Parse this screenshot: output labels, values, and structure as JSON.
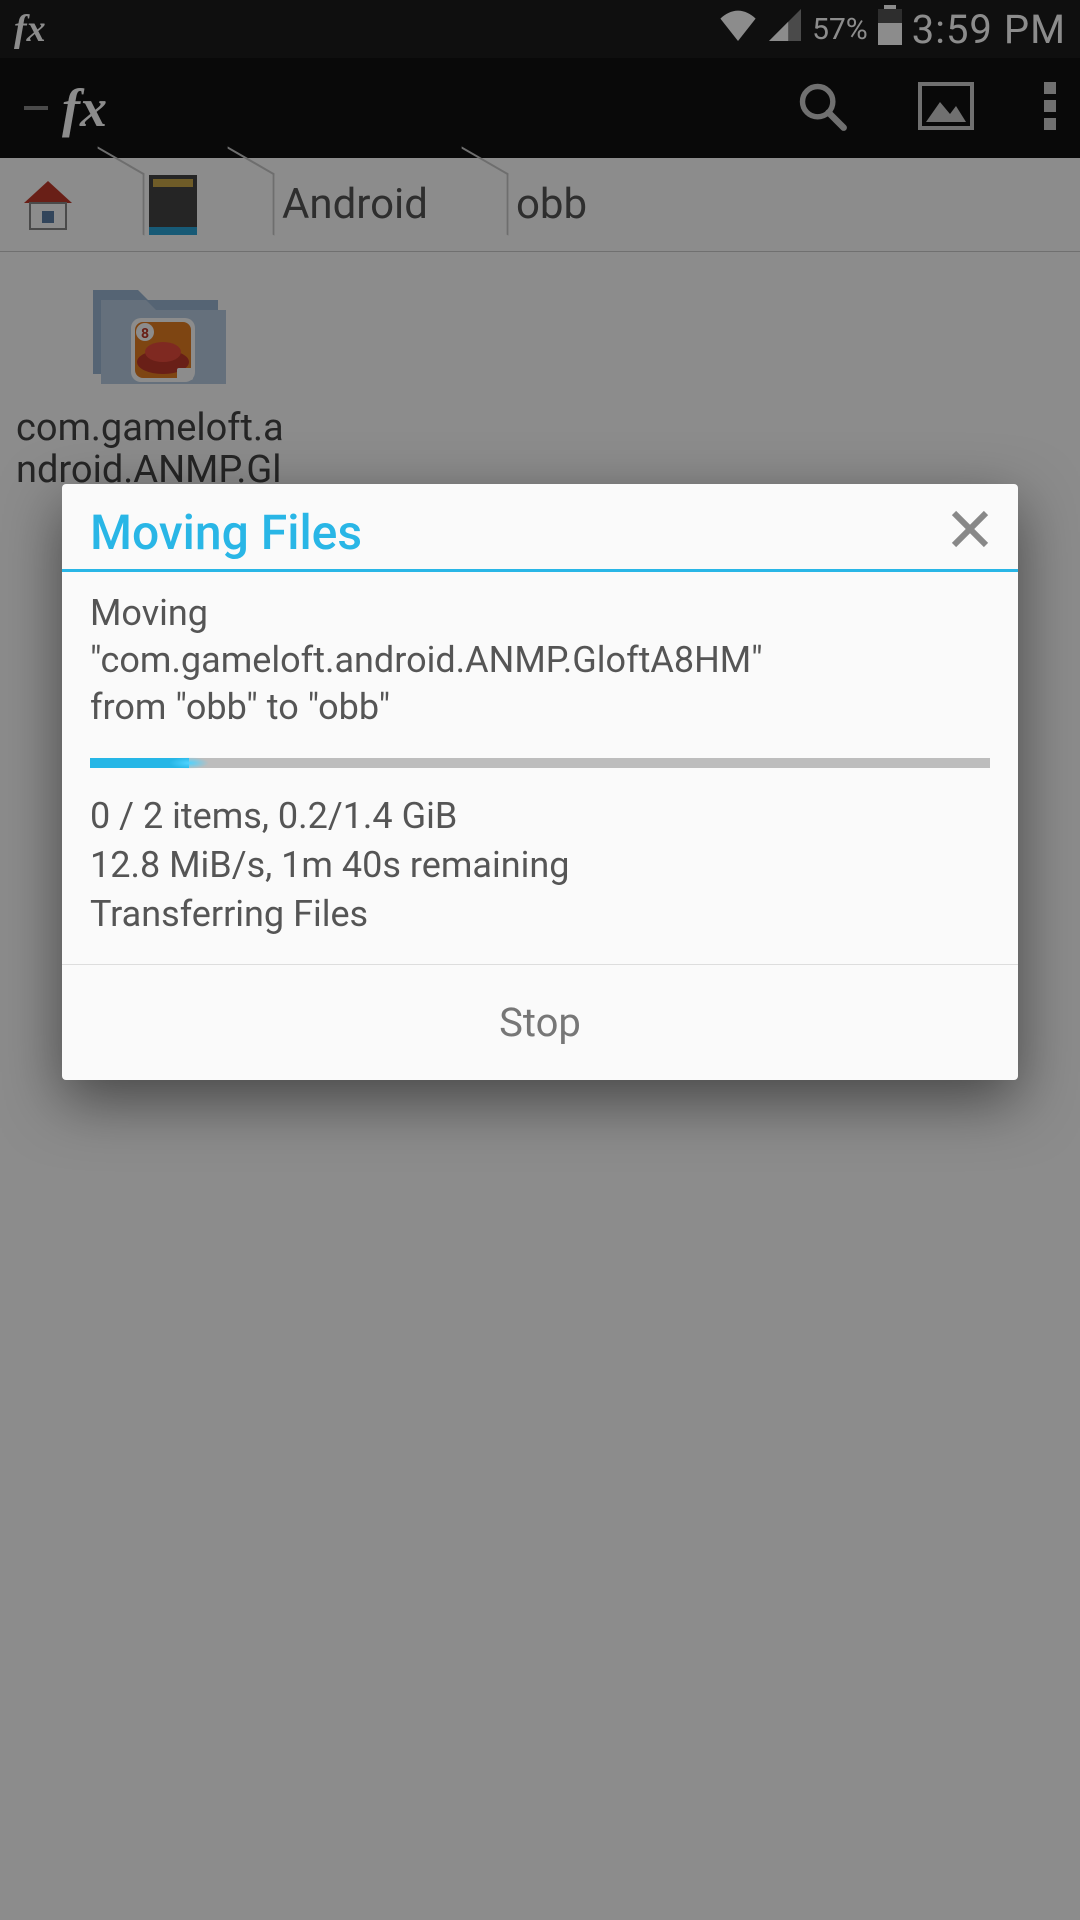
{
  "statusbar": {
    "battery_pct": "57%",
    "time": "3:59 PM"
  },
  "breadcrumbs": {
    "items": [
      "Android",
      "obb"
    ]
  },
  "folder": {
    "name": "com.gameloft.android.ANMP.Gl",
    "badge": "8"
  },
  "dialog": {
    "title": "Moving Files",
    "desc_line1": "Moving",
    "desc_line2": "\"com.gameloft.android.ANMP.GloftA8HM\"",
    "desc_line3": "from \"obb\" to \"obb\"",
    "progress_pct": "11%",
    "stats_line1": "0 / 2 items, 0.2/1.4 GiB",
    "stats_line2": "12.8 MiB/s, 1m 40s remaining",
    "stats_line3": "Transferring Files",
    "stop_label": "Stop"
  }
}
